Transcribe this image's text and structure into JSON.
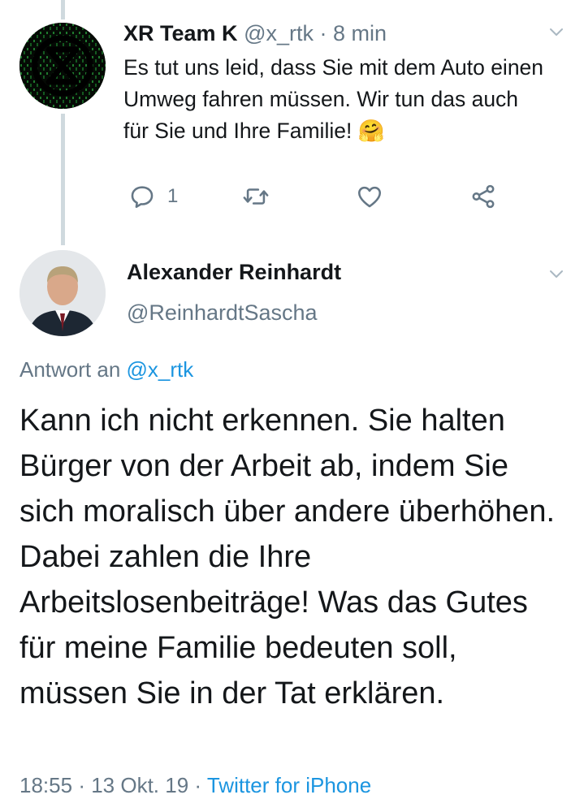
{
  "tweet1": {
    "display_name": "XR Team K",
    "handle": "@x_rtk",
    "separator": "·",
    "time": "8 min",
    "text": "Es tut uns leid, dass Sie mit dem Auto einen Umweg fahren müssen. Wir tun das auch für Sie und Ihre Familie!",
    "emoji": "🤗",
    "actions": {
      "reply_count": "1"
    }
  },
  "tweet2": {
    "display_name": "Alexander Reinhardt",
    "handle": "@ReinhardtSascha",
    "reply_prefix": "Antwort an",
    "reply_handle": "@x_rtk",
    "text": "Kann ich nicht erkennen. Sie halten Bürger von der Arbeit ab, indem Sie sich moralisch über andere überhöhen. Dabei zahlen die Ihre Arbeitslosenbeiträge! Was das Gutes für meine Familie bedeuten soll, müssen Sie in der Tat erklären.",
    "time": "18:55",
    "sep1": "·",
    "date": "13 Okt. 19",
    "sep2": "·",
    "source": "Twitter for iPhone"
  },
  "colors": {
    "link": "#1b95e0",
    "muted": "#657786",
    "text": "#14171a",
    "thread_line": "#cfd9de"
  }
}
